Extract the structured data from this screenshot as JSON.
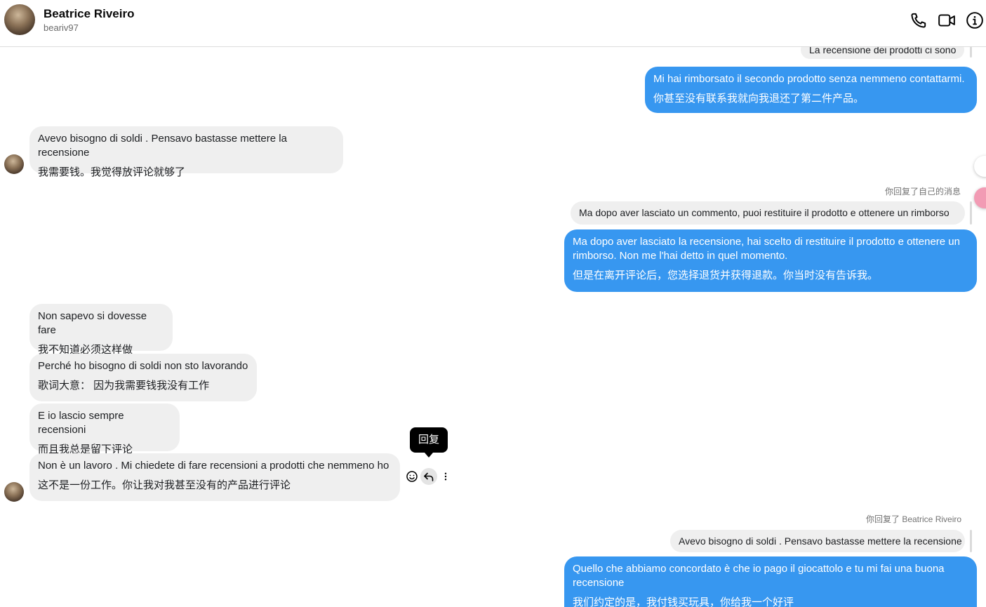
{
  "header": {
    "name": "Beatrice Riveiro",
    "username": "beariv97",
    "icons": [
      "phone-icon",
      "video-camera-icon",
      "info-icon"
    ]
  },
  "messages": {
    "m0_quote": "La recensione dei prodotti ci sono",
    "m1": {
      "text": "Mi hai rimborsato il secondo prodotto senza nemmeno contattarmi.",
      "translation": "你甚至没有联系我就向我退还了第二件产品。"
    },
    "m2": {
      "text": "Avevo bisogno di soldi . Pensavo bastasse mettere la recensione",
      "translation": "我需要钱。我觉得放评论就够了"
    },
    "m3": {
      "reply_note": "你回复了自己的消息",
      "quote": "Ma dopo aver lasciato un commento, puoi restituire il prodotto e ottenere un rimborso",
      "text": "Ma dopo aver lasciato la recensione, hai scelto di restituire il prodotto e ottenere un rimborso. Non me l'hai detto in quel momento.",
      "translation": "但是在离开评论后，您选择退货并获得退款。你当时没有告诉我。"
    },
    "m4": {
      "text": "Non sapevo si dovesse fare",
      "translation": "我不知道必须这样做"
    },
    "m5": {
      "text": "Perché ho bisogno di soldi non sto lavorando",
      "translation": "歌词大意： 因为我需要钱我没有工作"
    },
    "m6": {
      "text": "E io lascio sempre recensioni",
      "translation": "而且我总是留下评论"
    },
    "m7": {
      "text": "Non è un lavoro . Mi chiedete di fare recensioni a prodotti che nemmeno ho",
      "translation": "这不是一份工作。你让我对我甚至没有的产品进行评论"
    },
    "tooltip": "回复",
    "m8": {
      "reply_note": "你回复了 Beatrice Riveiro",
      "quote": "Avevo bisogno di soldi . Pensavo bastasse mettere la recensione",
      "text": "Quello che abbiamo concordato è che io pago il giocattolo e tu mi fai una buona recensione",
      "translation": "我们约定的是，我付钱买玩具，你给我一个好评"
    }
  },
  "colors": {
    "outgoing_bubble": "#3797f0",
    "incoming_bubble": "#efefef",
    "tooltip_bg": "#000000"
  }
}
